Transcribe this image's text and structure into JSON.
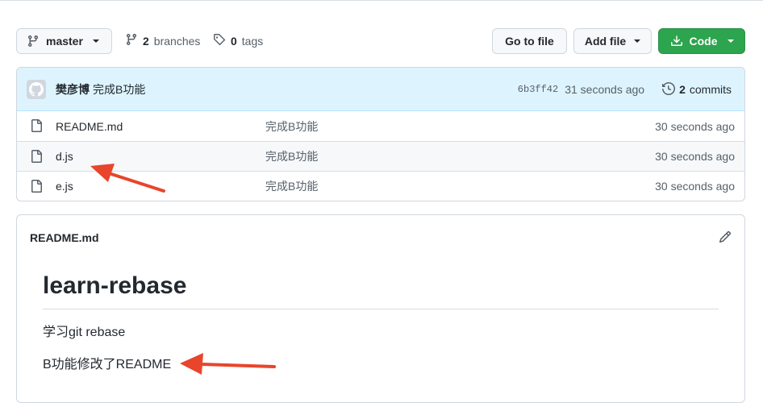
{
  "toolbar": {
    "branch_name": "master",
    "branches_count": "2",
    "branches_label": "branches",
    "tags_count": "0",
    "tags_label": "tags",
    "goto_file_label": "Go to file",
    "add_file_label": "Add file",
    "code_label": "Code"
  },
  "latest_commit": {
    "author": "樊彦博",
    "message": "完成B功能",
    "sha": "6b3ff42",
    "time": "31 seconds ago",
    "commits_count": "2",
    "commits_label": "commits"
  },
  "files": [
    {
      "name": "README.md",
      "message": "完成B功能",
      "time": "30 seconds ago"
    },
    {
      "name": "d.js",
      "message": "完成B功能",
      "time": "30 seconds ago"
    },
    {
      "name": "e.js",
      "message": "完成B功能",
      "time": "30 seconds ago"
    }
  ],
  "readme": {
    "filename": "README.md",
    "heading": "learn-rebase",
    "paragraphs": [
      "学习git rebase",
      "B功能修改了README"
    ]
  },
  "colors": {
    "accent_green": "#2da44e",
    "commit_bar_bg": "#ddf4ff",
    "annotation_red": "#e8452c"
  },
  "icons": [
    "branch-icon",
    "tag-icon",
    "download-icon",
    "avatar-icon",
    "history-icon",
    "file-icon",
    "pencil-icon"
  ]
}
